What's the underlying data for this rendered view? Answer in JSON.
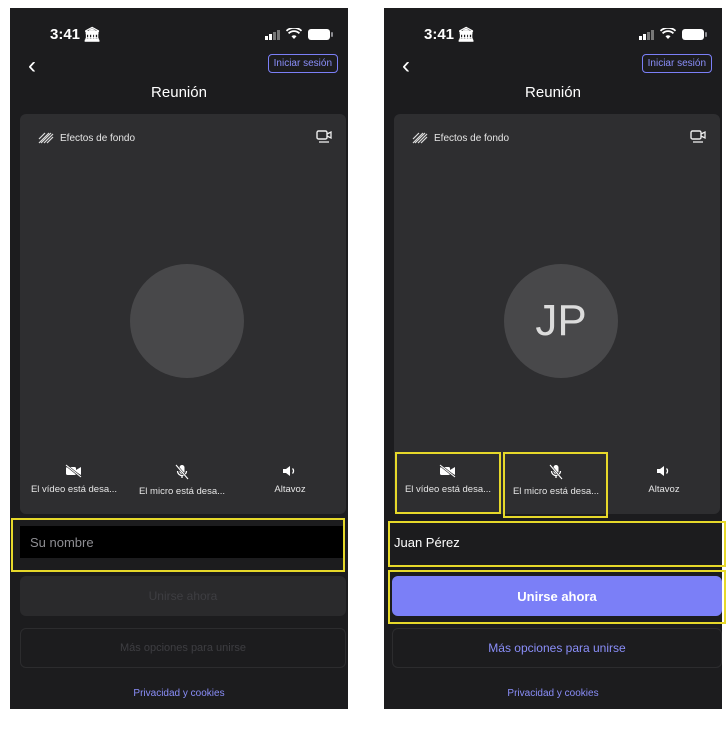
{
  "screens": [
    {
      "status": {
        "time": "3:41",
        "time_icon": "bank-icon"
      },
      "header": {
        "back_icon": "back-chevron-icon",
        "signin_label": "Iniciar sesión",
        "title": "Reunión"
      },
      "preview": {
        "effects_label": "Efectos de fondo",
        "avatar_initials": "",
        "video_label": "El vídeo está desa...",
        "mic_label": "El micro está desa...",
        "speaker_label": "Altavoz"
      },
      "name_input": {
        "value": "",
        "placeholder": "Su nombre"
      },
      "join_label": "Unirse ahora",
      "more_label": "Más opciones para unirse",
      "privacy_label": "Privacidad y cookies"
    },
    {
      "status": {
        "time": "3:41",
        "time_icon": "bank-icon"
      },
      "header": {
        "back_icon": "back-chevron-icon",
        "signin_label": "Iniciar sesión",
        "title": "Reunión"
      },
      "preview": {
        "effects_label": "Efectos de fondo",
        "avatar_initials": "JP",
        "video_label": "El vídeo está desa...",
        "mic_label": "El micro está desa...",
        "speaker_label": "Altavoz"
      },
      "name_input": {
        "value": "Juan Pérez",
        "placeholder": ""
      },
      "join_label": "Unirse ahora",
      "more_label": "Más opciones para unirse",
      "privacy_label": "Privacidad y cookies"
    }
  ],
  "colors": {
    "accent": "#7b7ff7",
    "highlight": "#e6d82a",
    "background": "#1c1c1e",
    "panel": "#2e2e30"
  }
}
